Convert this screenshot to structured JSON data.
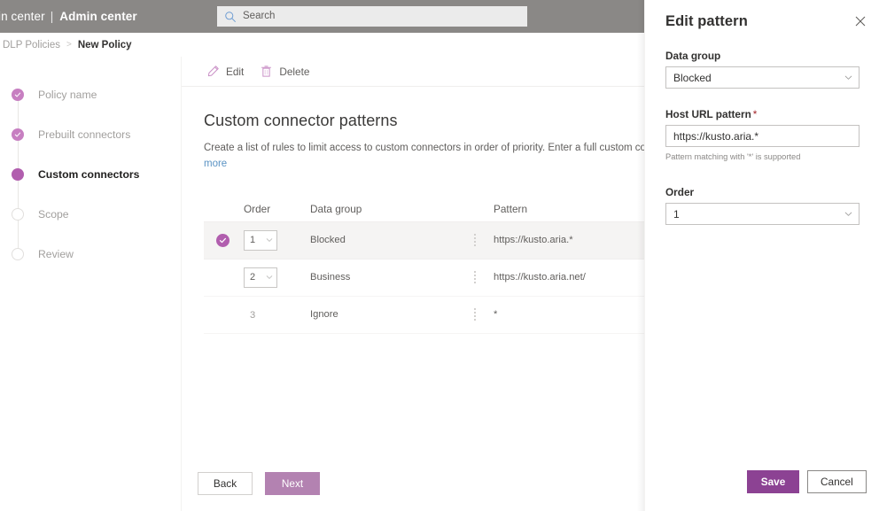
{
  "suite": {
    "brand_left": "in center",
    "brand_right": "Admin center",
    "separator": "|",
    "search_placeholder": "Search",
    "search_icon": "search-icon",
    "bar_color": "#8a8886"
  },
  "breadcrumb": {
    "items": [
      {
        "label": "DLP Policies",
        "current": false
      },
      {
        "label": "New Policy",
        "current": true
      }
    ],
    "separator": ">"
  },
  "wizard": {
    "steps": [
      {
        "label": "Policy name",
        "state": "done"
      },
      {
        "label": "Prebuilt connectors",
        "state": "done"
      },
      {
        "label": "Custom connectors",
        "state": "active"
      },
      {
        "label": "Scope",
        "state": "pending"
      },
      {
        "label": "Review",
        "state": "pending"
      }
    ],
    "accent": "#b15eae"
  },
  "commandbar": {
    "edit_label": "Edit",
    "edit_icon": "pencil-icon",
    "delete_label": "Delete",
    "delete_icon": "trash-icon"
  },
  "main": {
    "title": "Custom connector patterns",
    "description": "Create a list of rules to limit access to custom connectors in order of priority. Enter a full custom connector U",
    "more_link": "more"
  },
  "table": {
    "columns": {
      "order": "Order",
      "data_group": "Data group",
      "pattern": "Pattern"
    },
    "rows": [
      {
        "selected": true,
        "order": "1",
        "order_is_select": true,
        "data_group": "Blocked",
        "pattern": "https://kusto.aria.*"
      },
      {
        "selected": false,
        "order": "2",
        "order_is_select": true,
        "data_group": "Business",
        "pattern": "https://kusto.aria.net/"
      },
      {
        "selected": false,
        "order": "3",
        "order_is_select": false,
        "data_group": "Ignore",
        "pattern": "*"
      }
    ]
  },
  "footer": {
    "back_label": "Back",
    "next_label": "Next",
    "next_color": "#b382b1"
  },
  "panel": {
    "title": "Edit pattern",
    "close_icon": "close-icon",
    "data_group": {
      "label": "Data group",
      "value": "Blocked",
      "chevron_icon": "chevron-down-icon"
    },
    "host_url": {
      "label": "Host URL pattern",
      "required_marker": "*",
      "value": "https://kusto.aria.*",
      "hint": "Pattern matching with '*' is supported"
    },
    "order": {
      "label": "Order",
      "value": "1",
      "chevron_icon": "chevron-down-icon"
    },
    "save_label": "Save",
    "cancel_label": "Cancel",
    "save_color": "#8c4293"
  }
}
